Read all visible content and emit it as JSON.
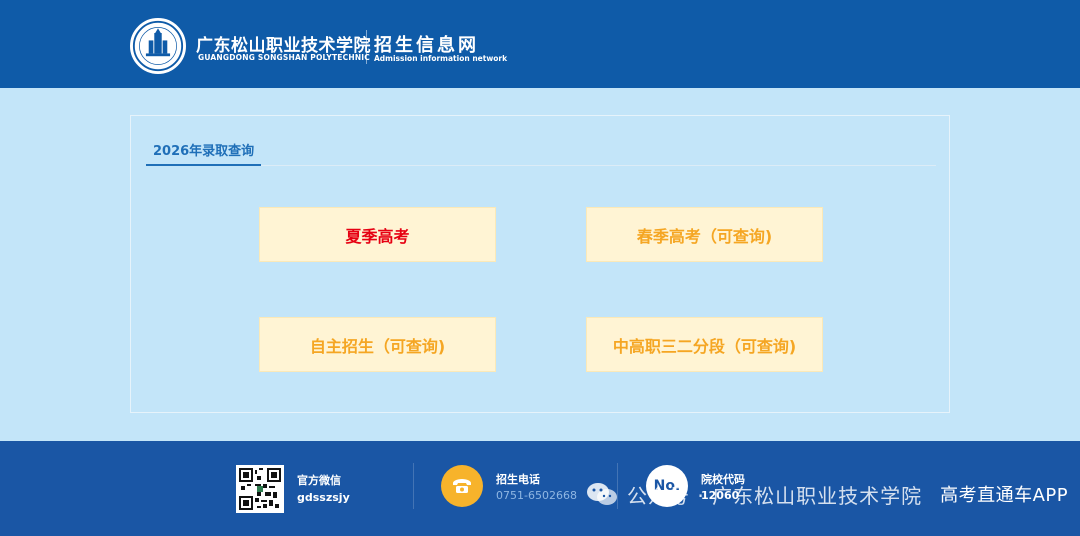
{
  "header": {
    "school_name_cn": "广东松山职业技术学院",
    "school_name_en": "GUANGDONG SONGSHAN POLYTECHNIC",
    "site_title_cn": "招生信息网",
    "site_title_en": "Admission information network",
    "logo_icon": "college-seal-icon"
  },
  "panel": {
    "tab_label": "2026年录取查询",
    "buttons": [
      {
        "label": "夏季高考",
        "color": "#e60012"
      },
      {
        "label": "春季高考（可查询)",
        "color": "#f5a623"
      },
      {
        "label": "自主招生（可查询)",
        "color": "#f5a623"
      },
      {
        "label": "中高职三二分段（可查询)",
        "color": "#f5a623"
      }
    ]
  },
  "footer": {
    "wechat_title": "官方微信",
    "wechat_id": "gdsszsjy",
    "phone_title": "招生电话",
    "phone_number": "0751-6502668",
    "code_title": "院校代码",
    "code_value": "12060",
    "code_icon_text": "No."
  },
  "watermark": {
    "text": "公众号 · 广东松山职业技术学院",
    "text2": "高考直通车APP"
  },
  "colors": {
    "header_bg": "#0f5ba8",
    "page_bg": "#c3e5f9",
    "footer_bg": "#1a56a5",
    "accent": "#1f6fb8",
    "button_bg": "#fff4d4"
  }
}
